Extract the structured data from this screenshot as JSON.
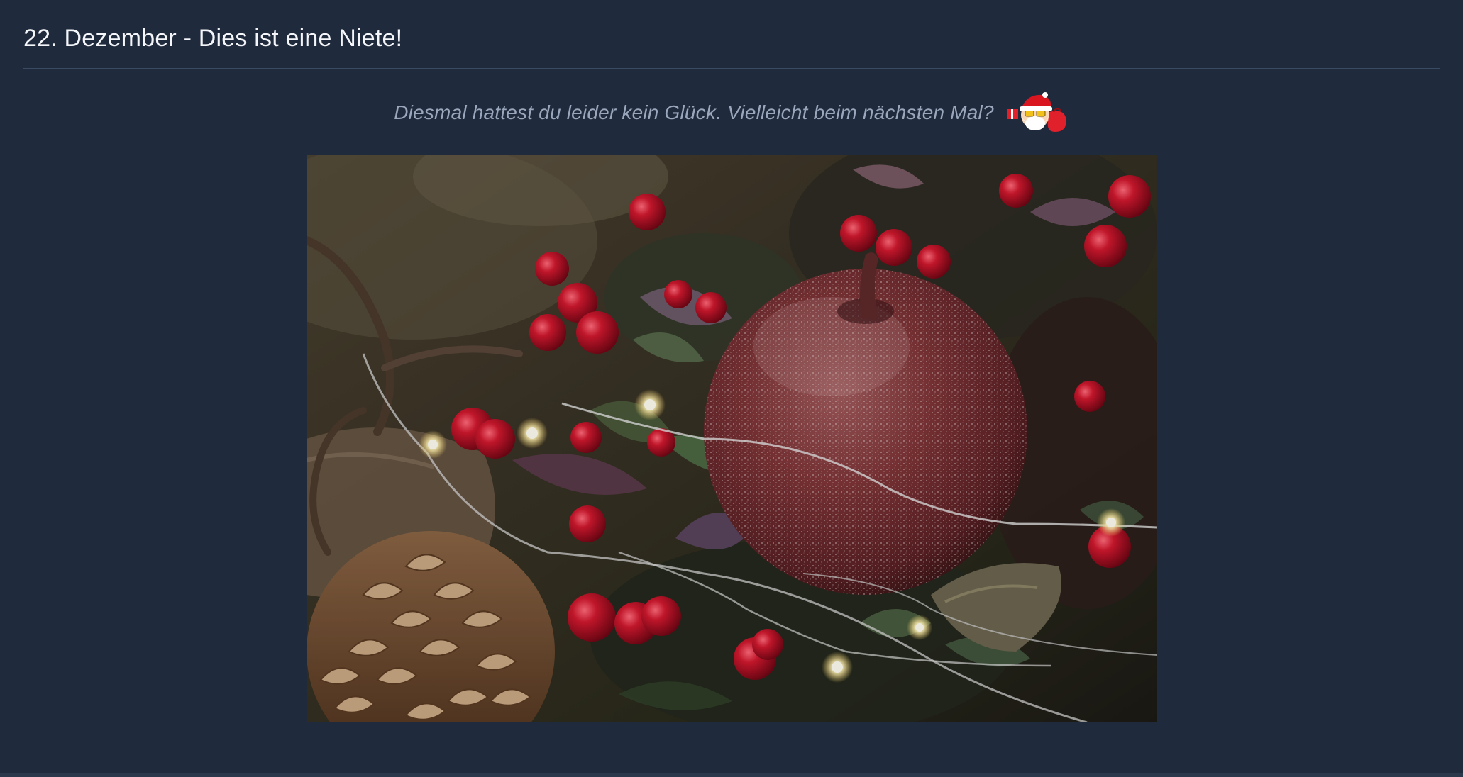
{
  "header": {
    "title": "22. Dezember - Dies ist eine Niete!"
  },
  "message": {
    "text": "Diesmal hattest du leider kein Glück. Vielleicht beim nächsten Mal?",
    "emoji_icon": "santa-with-gift-icon"
  },
  "photo": {
    "subject": "frosted-red-apple-with-berries-and-pinecone",
    "alt": ""
  },
  "colors": {
    "background": "#1f2a3c",
    "divider": "#3a4a63",
    "title_text": "#f4f6fa",
    "subtitle_text": "#9aa6bb",
    "berry_red": "#b3122b",
    "apple_red": "#7a2a2e"
  }
}
